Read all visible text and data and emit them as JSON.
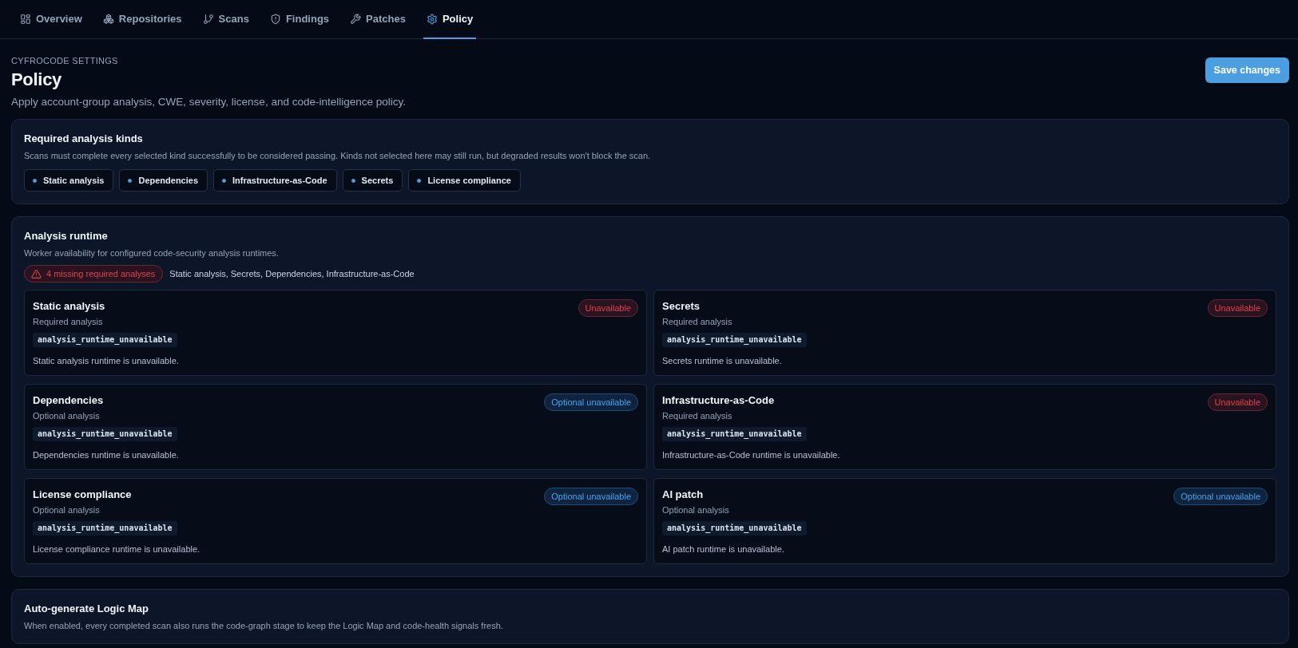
{
  "nav": {
    "tabs": [
      {
        "label": "Overview",
        "selected": false
      },
      {
        "label": "Repositories",
        "selected": false
      },
      {
        "label": "Scans",
        "selected": false
      },
      {
        "label": "Findings",
        "selected": false
      },
      {
        "label": "Patches",
        "selected": false
      },
      {
        "label": "Policy",
        "selected": true
      }
    ]
  },
  "header": {
    "eyebrow": "CYFROCODE SETTINGS",
    "title": "Policy",
    "subtitle": "Apply account-group analysis, CWE, severity, license, and code-intelligence policy.",
    "save_button": "Save changes"
  },
  "required_kinds": {
    "title": "Required analysis kinds",
    "description": "Scans must complete every selected kind successfully to be considered passing. Kinds not selected here may still run, but degraded results won't block the scan.",
    "kinds": [
      {
        "label": "Static analysis",
        "selected": true
      },
      {
        "label": "Dependencies",
        "selected": true
      },
      {
        "label": "Infrastructure-as-Code",
        "selected": true
      },
      {
        "label": "Secrets",
        "selected": true
      },
      {
        "label": "License compliance",
        "selected": true
      }
    ]
  },
  "runtime": {
    "title": "Analysis runtime",
    "description": "Worker availability for configured code-security analysis runtimes.",
    "missing": {
      "label": "4 missing required analyses",
      "list": "Static analysis, Secrets, Dependencies, Infrastructure-as-Code"
    },
    "runtimes": [
      {
        "name": "Static analysis",
        "requirement": "Required analysis",
        "code": "analysis_runtime_unavailable",
        "message": "Static analysis runtime is unavailable.",
        "status": {
          "kind": "danger",
          "label": "Unavailable"
        }
      },
      {
        "name": "Secrets",
        "requirement": "Required analysis",
        "code": "analysis_runtime_unavailable",
        "message": "Secrets runtime is unavailable.",
        "status": {
          "kind": "danger",
          "label": "Unavailable"
        }
      },
      {
        "name": "Dependencies",
        "requirement": "Optional analysis",
        "code": "analysis_runtime_unavailable",
        "message": "Dependencies runtime is unavailable.",
        "status": {
          "kind": "info",
          "label": "Optional unavailable"
        }
      },
      {
        "name": "Infrastructure-as-Code",
        "requirement": "Required analysis",
        "code": "analysis_runtime_unavailable",
        "message": "Infrastructure-as-Code runtime is unavailable.",
        "status": {
          "kind": "danger",
          "label": "Unavailable"
        }
      },
      {
        "name": "License compliance",
        "requirement": "Optional analysis",
        "code": "analysis_runtime_unavailable",
        "message": "License compliance runtime is unavailable.",
        "status": {
          "kind": "info",
          "label": "Optional unavailable"
        }
      },
      {
        "name": "AI patch",
        "requirement": "Optional analysis",
        "code": "analysis_runtime_unavailable",
        "message": "AI patch runtime is unavailable.",
        "status": {
          "kind": "info",
          "label": "Optional unavailable"
        }
      }
    ]
  },
  "logic_map": {
    "title": "Auto-generate Logic Map",
    "description": "When enabled, every completed scan also runs the code-graph stage to keep the Logic Map and code-health signals fresh."
  }
}
